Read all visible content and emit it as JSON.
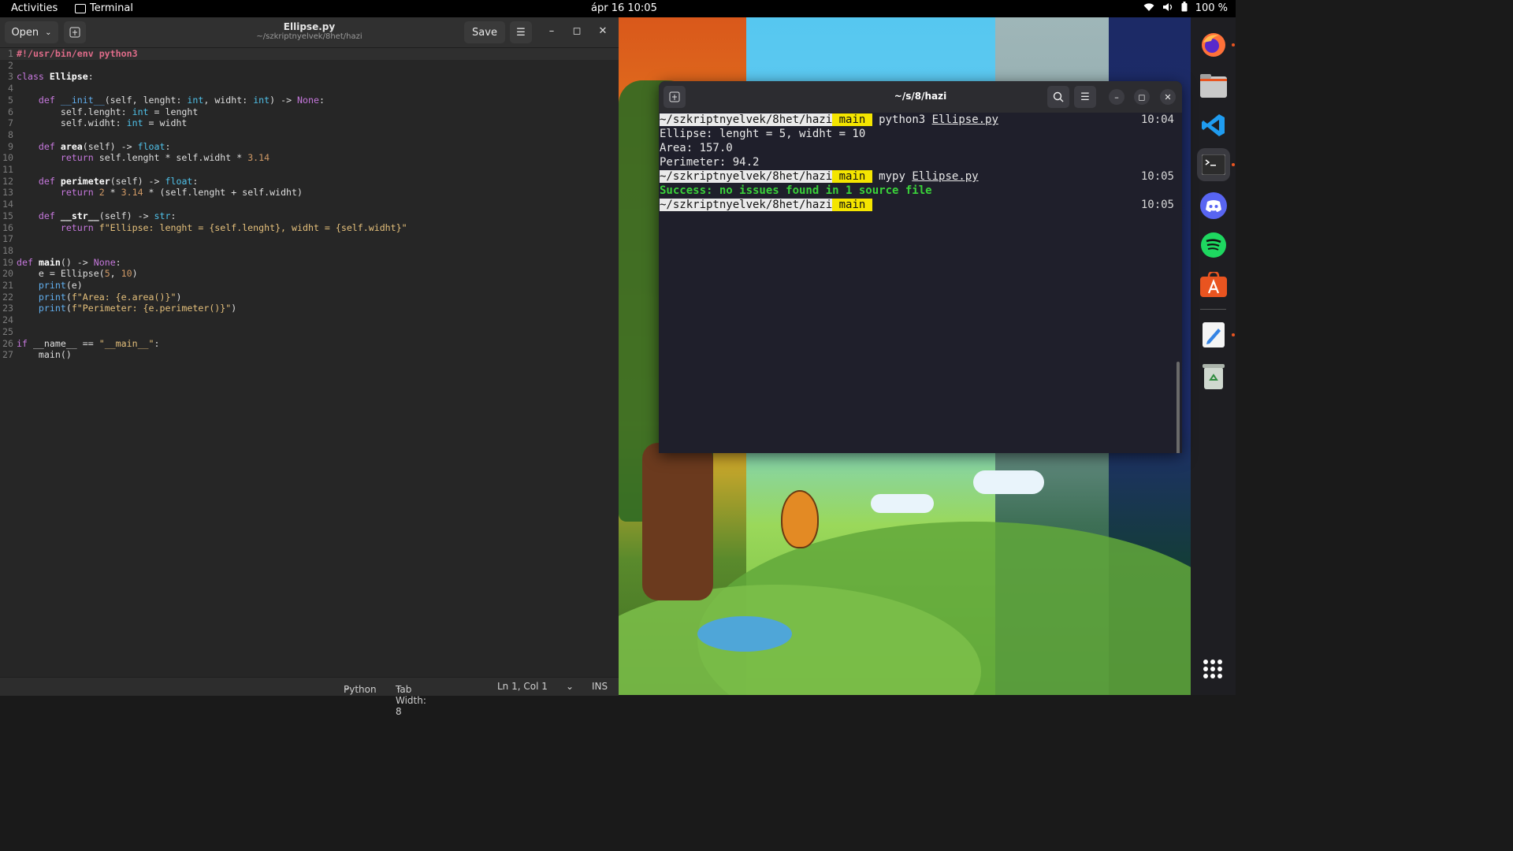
{
  "topbar": {
    "activities": "Activities",
    "app_name": "Terminal",
    "clock": "ápr 16  10:05",
    "battery": "100 %"
  },
  "editor": {
    "open_label": "Open",
    "title": "Ellipse.py",
    "subtitle": "~/szkriptnyelvek/8het/hazi",
    "save_label": "Save",
    "status": {
      "language": "Python",
      "tab_width": "Tab Width: 8",
      "position": "Ln 1, Col 1",
      "mode": "INS"
    },
    "line_numbers": [
      "1",
      "2",
      "3",
      "4",
      "5",
      "6",
      "7",
      "8",
      "9",
      "10",
      "11",
      "12",
      "13",
      "14",
      "15",
      "16",
      "17",
      "18",
      "19",
      "20",
      "21",
      "22",
      "23",
      "24",
      "25",
      "26",
      "27"
    ]
  },
  "terminal": {
    "title": "~/s/8/hazi",
    "prompt_dir": "~/szkriptnyelvek/8het/hazi",
    "prompt_branch": " main ",
    "cmd1": "python3",
    "cmd2": "mypy",
    "file": "Ellipse.py",
    "out1": "Ellipse: lenght = 5, widht = 10",
    "out2": "Area: 157.0",
    "out3": "Perimeter: 94.2",
    "out4": "Success: no issues found in 1 source file",
    "time1": "10:04",
    "time2": "10:05",
    "time3": "10:05"
  },
  "dock": {
    "apps": [
      "firefox-icon",
      "files-icon",
      "vscode-icon",
      "terminal-icon",
      "discord-icon",
      "spotify-icon",
      "app-center-icon",
      "text-editor-icon",
      "trash-icon"
    ]
  },
  "colors": {
    "prompt_branch_bg": "#f4e500",
    "success_green": "#3ad13a",
    "accent_orange": "#e95420"
  }
}
